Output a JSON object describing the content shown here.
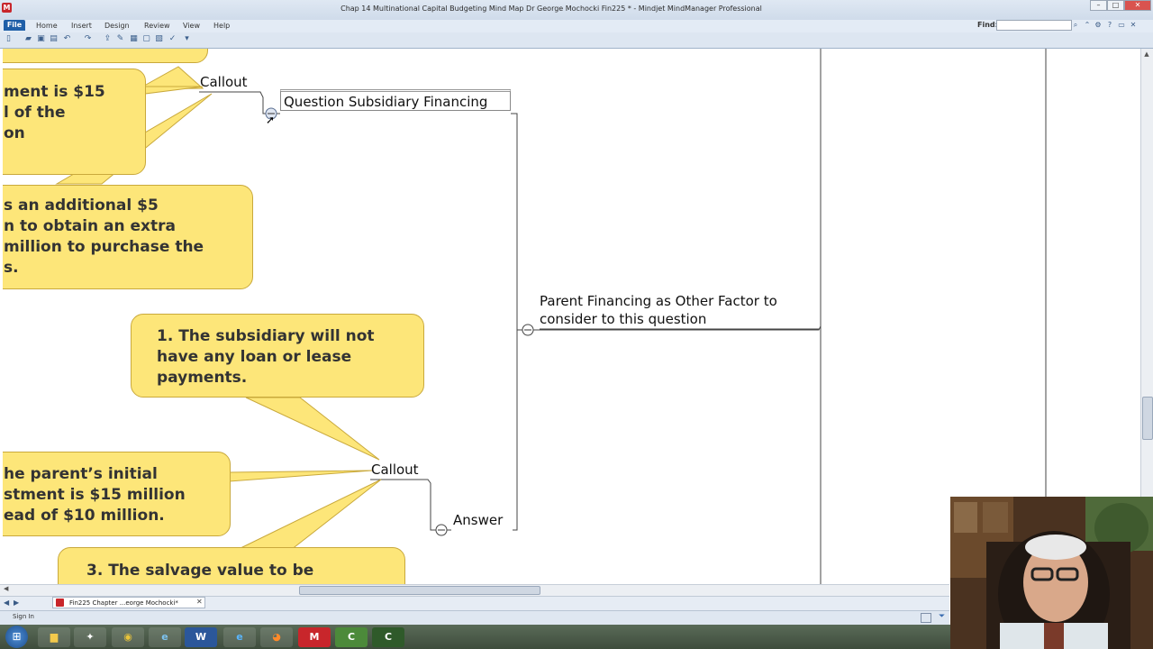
{
  "window": {
    "title": "Chap 14 Multinational Capital Budgeting Mind Map Dr George Mochocki Fin225 * - Mindjet MindManager Professional",
    "app_icon": "M"
  },
  "ribbon": {
    "file_label": "File",
    "tabs": [
      "Home",
      "Insert",
      "Design",
      "Review",
      "View",
      "Help"
    ],
    "find_label": "Find:",
    "find_value": ""
  },
  "map": {
    "callout_label_1": "Callout",
    "callout_label_2": "Callout",
    "topic_question": "Question Subsidiary Financing",
    "topic_parent_financing_1": "Parent Financing as Other Factor to",
    "topic_parent_financing_2": "consider to this question",
    "topic_answer": "Answer",
    "bubble_top_partial": [
      "ment is $15",
      "l of the",
      "on"
    ],
    "bubble_mid_partial": [
      "s an additional $5",
      "n to obtain an extra",
      "million to purchase the",
      "s."
    ],
    "bubble_1": [
      "1. The subsidiary will not",
      "have any loan or lease",
      "payments."
    ],
    "bubble_2_partial": [
      "he parent’s initial",
      "stment is $15 million",
      "ead of $10 million."
    ],
    "bubble_3_partial": [
      "3. The salvage value to be"
    ]
  },
  "tabs_bar": {
    "doc_tab": "Fin225 Chapter ...eorge Mochocki*"
  },
  "status": {
    "signin": "Sign In"
  },
  "taskbar": {
    "items": [
      "start-icon",
      "explorer-icon",
      "tool-icon",
      "chrome-icon",
      "ie-blue-icon",
      "word-icon",
      "ie-icon",
      "firefox-icon",
      "mindmanager-icon",
      "camtasia-green-icon",
      "camtasia-icon"
    ]
  }
}
